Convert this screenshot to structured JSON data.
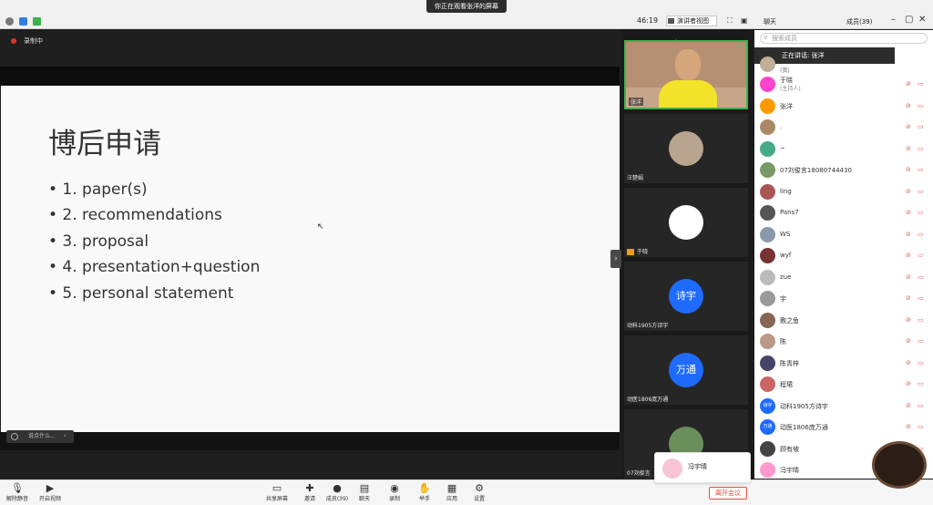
{
  "banner": "你正在观看张洋的屏幕",
  "topbar": {
    "timer": "46:19",
    "view_select": "演讲者视图",
    "chat_tab": "聊天",
    "members_tab": "成员(39)"
  },
  "share": {
    "recording": "录制中",
    "say_placeholder": "说点什么..."
  },
  "slide": {
    "title": "博后申请",
    "bullets": [
      "• 1. paper(s)",
      "• 2. recommendations",
      "• 3. proposal",
      "• 4. presentation+question",
      "• 5. personal statement"
    ]
  },
  "videos": [
    {
      "name": "张洋"
    },
    {
      "name": "汪楚娟"
    },
    {
      "name": "于晓"
    },
    {
      "name": "动科1905方诗宇",
      "avatar_text": "诗宇"
    },
    {
      "name": "动医1806庞万通",
      "avatar_text": "万通"
    },
    {
      "name": "07刘俊言"
    }
  ],
  "panel": {
    "search_placeholder": "搜索成员",
    "speaking": "正在讲话: 张洋",
    "me": "(我)",
    "members": [
      {
        "name": "于晓",
        "sub": "(主持人)",
        "color": "#f4c"
      },
      {
        "name": "张洋",
        "color": "#f90"
      },
      {
        "name": ".",
        "color": "#a86"
      },
      {
        "name": "~",
        "color": "#4a8"
      },
      {
        "name": "07刘俊言18080744430",
        "color": "#796"
      },
      {
        "name": "ling",
        "color": "#a55"
      },
      {
        "name": "Pans7",
        "color": "#555"
      },
      {
        "name": "WS",
        "color": "#89a"
      },
      {
        "name": "wyf",
        "color": "#733"
      },
      {
        "name": "zue",
        "color": "#bbb"
      },
      {
        "name": "宇",
        "color": "#999"
      },
      {
        "name": "敷之鱼",
        "color": "#865"
      },
      {
        "name": "陈",
        "color": "#b98"
      },
      {
        "name": "陈青梓",
        "color": "#446"
      },
      {
        "name": "程珺",
        "color": "#c66"
      },
      {
        "name": "动科1905方诗宇",
        "avatar_text": "诗宇",
        "color": "#1f6bff"
      },
      {
        "name": "动医1806庞万通",
        "avatar_text": "万通",
        "color": "#1f6bff"
      },
      {
        "name": "顾有坡",
        "color": "#444"
      },
      {
        "name": "冯宇晴",
        "color": "#f9c"
      }
    ]
  },
  "toolbar": {
    "unmute": "解除静音",
    "start_video": "开启视频",
    "share_screen": "共享屏幕",
    "invite": "邀请",
    "members": "成员(39)",
    "chat": "聊天",
    "record": "录制",
    "raise_hand": "举手",
    "apps": "应用",
    "settings": "设置",
    "leave": "离开会议"
  },
  "popup": {
    "name": "冯宇晴"
  }
}
